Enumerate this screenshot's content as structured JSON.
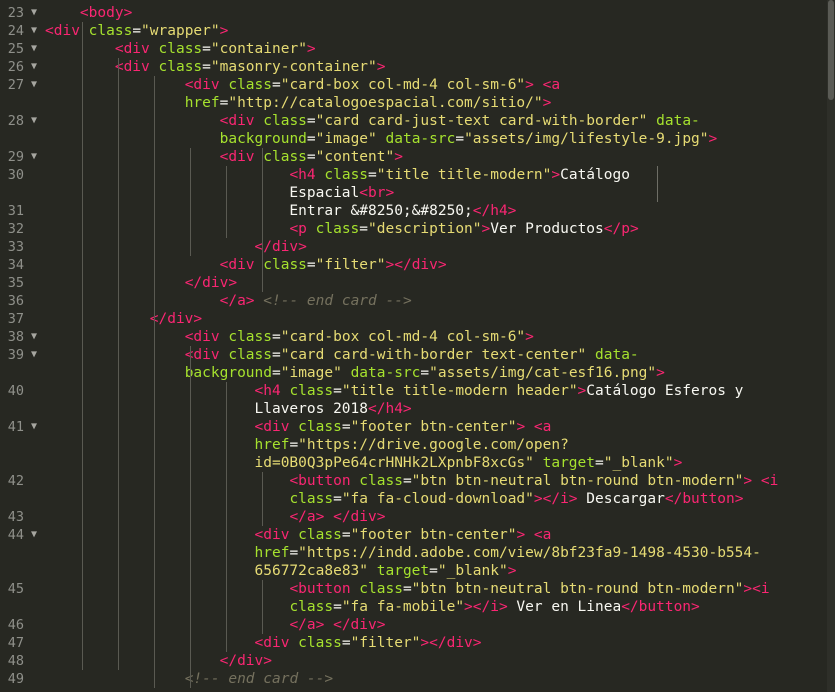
{
  "gutter": [
    {
      "n": "23",
      "fold": true
    },
    {
      "n": "24",
      "fold": true
    },
    {
      "n": "25",
      "fold": true
    },
    {
      "n": "26",
      "fold": true
    },
    {
      "n": "27",
      "fold": true
    },
    {
      "n": "",
      "fold": false
    },
    {
      "n": "28",
      "fold": true
    },
    {
      "n": "",
      "fold": false
    },
    {
      "n": "29",
      "fold": true
    },
    {
      "n": "30",
      "fold": false
    },
    {
      "n": "",
      "fold": false
    },
    {
      "n": "31",
      "fold": false
    },
    {
      "n": "32",
      "fold": false
    },
    {
      "n": "33",
      "fold": false
    },
    {
      "n": "34",
      "fold": false
    },
    {
      "n": "35",
      "fold": false
    },
    {
      "n": "36",
      "fold": false
    },
    {
      "n": "37",
      "fold": false
    },
    {
      "n": "38",
      "fold": true
    },
    {
      "n": "39",
      "fold": true
    },
    {
      "n": "",
      "fold": false
    },
    {
      "n": "40",
      "fold": false
    },
    {
      "n": "",
      "fold": false
    },
    {
      "n": "41",
      "fold": true
    },
    {
      "n": "",
      "fold": false
    },
    {
      "n": "",
      "fold": false
    },
    {
      "n": "42",
      "fold": false
    },
    {
      "n": "",
      "fold": false
    },
    {
      "n": "43",
      "fold": false
    },
    {
      "n": "44",
      "fold": true
    },
    {
      "n": "",
      "fold": false
    },
    {
      "n": "",
      "fold": false
    },
    {
      "n": "45",
      "fold": false
    },
    {
      "n": "",
      "fold": false
    },
    {
      "n": "46",
      "fold": false
    },
    {
      "n": "47",
      "fold": false
    },
    {
      "n": "48",
      "fold": false
    },
    {
      "n": "49",
      "fold": false
    }
  ],
  "lines": [
    [
      {
        "k": "p",
        "v": "    "
      },
      {
        "k": "t",
        "v": "<body>"
      }
    ],
    [
      {
        "k": "t",
        "v": "<div"
      },
      {
        "k": "p",
        "v": " "
      },
      {
        "k": "a",
        "v": "class"
      },
      {
        "k": "p",
        "v": "="
      },
      {
        "k": "s",
        "v": "\"wrapper\""
      },
      {
        "k": "t",
        "v": ">"
      }
    ],
    [
      {
        "k": "p",
        "v": "        "
      },
      {
        "k": "t",
        "v": "<div"
      },
      {
        "k": "p",
        "v": " "
      },
      {
        "k": "a",
        "v": "class"
      },
      {
        "k": "p",
        "v": "="
      },
      {
        "k": "s",
        "v": "\"container\""
      },
      {
        "k": "t",
        "v": ">"
      }
    ],
    [
      {
        "k": "p",
        "v": "        "
      },
      {
        "k": "t",
        "v": "<div"
      },
      {
        "k": "p",
        "v": " "
      },
      {
        "k": "a",
        "v": "class"
      },
      {
        "k": "p",
        "v": "="
      },
      {
        "k": "s",
        "v": "\"masonry-container\""
      },
      {
        "k": "t",
        "v": ">"
      }
    ],
    [
      {
        "k": "p",
        "v": "                "
      },
      {
        "k": "t",
        "v": "<div"
      },
      {
        "k": "p",
        "v": " "
      },
      {
        "k": "a",
        "v": "class"
      },
      {
        "k": "p",
        "v": "="
      },
      {
        "k": "s",
        "v": "\"card-box col-md-4 col-sm-6\""
      },
      {
        "k": "t",
        "v": ">"
      },
      {
        "k": "p",
        "v": " "
      },
      {
        "k": "t",
        "v": "<a"
      }
    ],
    [
      {
        "k": "p",
        "v": "                "
      },
      {
        "k": "a",
        "v": "href"
      },
      {
        "k": "p",
        "v": "="
      },
      {
        "k": "s",
        "v": "\"http://catalogoespacial.com/sitio/\""
      },
      {
        "k": "t",
        "v": ">"
      }
    ],
    [
      {
        "k": "p",
        "v": "                    "
      },
      {
        "k": "t",
        "v": "<div"
      },
      {
        "k": "p",
        "v": " "
      },
      {
        "k": "a",
        "v": "class"
      },
      {
        "k": "p",
        "v": "="
      },
      {
        "k": "s",
        "v": "\"card card-just-text card-with-border\""
      },
      {
        "k": "p",
        "v": " "
      },
      {
        "k": "a",
        "v": "data-"
      }
    ],
    [
      {
        "k": "p",
        "v": "                    "
      },
      {
        "k": "a",
        "v": "background"
      },
      {
        "k": "p",
        "v": "="
      },
      {
        "k": "s",
        "v": "\"image\""
      },
      {
        "k": "p",
        "v": " "
      },
      {
        "k": "a",
        "v": "data-src"
      },
      {
        "k": "p",
        "v": "="
      },
      {
        "k": "s",
        "v": "\"assets/img/lifestyle-9.jpg\""
      },
      {
        "k": "t",
        "v": ">"
      }
    ],
    [
      {
        "k": "p",
        "v": "                    "
      },
      {
        "k": "t",
        "v": "<div"
      },
      {
        "k": "p",
        "v": " "
      },
      {
        "k": "a",
        "v": "class"
      },
      {
        "k": "p",
        "v": "="
      },
      {
        "k": "s",
        "v": "\"content\""
      },
      {
        "k": "t",
        "v": ">"
      }
    ],
    [
      {
        "k": "p",
        "v": "                            "
      },
      {
        "k": "t",
        "v": "<h4"
      },
      {
        "k": "p",
        "v": " "
      },
      {
        "k": "a",
        "v": "class"
      },
      {
        "k": "p",
        "v": "="
      },
      {
        "k": "s",
        "v": "\"title title-modern\""
      },
      {
        "k": "t",
        "v": ">"
      },
      {
        "k": "p",
        "v": "Catálogo"
      }
    ],
    [
      {
        "k": "p",
        "v": "                            Espacial"
      },
      {
        "k": "t",
        "v": "<br>"
      }
    ],
    [
      {
        "k": "p",
        "v": "                            Entrar &#8250;&#8250;"
      },
      {
        "k": "t",
        "v": "</h4>"
      }
    ],
    [
      {
        "k": "p",
        "v": "                            "
      },
      {
        "k": "t",
        "v": "<p"
      },
      {
        "k": "p",
        "v": " "
      },
      {
        "k": "a",
        "v": "class"
      },
      {
        "k": "p",
        "v": "="
      },
      {
        "k": "s",
        "v": "\"description\""
      },
      {
        "k": "t",
        "v": ">"
      },
      {
        "k": "p",
        "v": "Ver Productos"
      },
      {
        "k": "t",
        "v": "</p>"
      }
    ],
    [
      {
        "k": "p",
        "v": "                        "
      },
      {
        "k": "t",
        "v": "</div>"
      }
    ],
    [
      {
        "k": "p",
        "v": "                    "
      },
      {
        "k": "t",
        "v": "<div"
      },
      {
        "k": "p",
        "v": " "
      },
      {
        "k": "a",
        "v": "class"
      },
      {
        "k": "p",
        "v": "="
      },
      {
        "k": "s",
        "v": "\"filter\""
      },
      {
        "k": "t",
        "v": "></div>"
      }
    ],
    [
      {
        "k": "p",
        "v": "                "
      },
      {
        "k": "t",
        "v": "</div>"
      }
    ],
    [
      {
        "k": "p",
        "v": "                    "
      },
      {
        "k": "t",
        "v": "</a>"
      },
      {
        "k": "p",
        "v": " "
      },
      {
        "k": "c",
        "v": "<!-- end card -->"
      }
    ],
    [
      {
        "k": "p",
        "v": "            "
      },
      {
        "k": "t",
        "v": "</div>"
      }
    ],
    [
      {
        "k": "p",
        "v": "                "
      },
      {
        "k": "t",
        "v": "<div"
      },
      {
        "k": "p",
        "v": " "
      },
      {
        "k": "a",
        "v": "class"
      },
      {
        "k": "p",
        "v": "="
      },
      {
        "k": "s",
        "v": "\"card-box col-md-4 col-sm-6\""
      },
      {
        "k": "t",
        "v": ">"
      }
    ],
    [
      {
        "k": "p",
        "v": "                "
      },
      {
        "k": "t",
        "v": "<div"
      },
      {
        "k": "p",
        "v": " "
      },
      {
        "k": "a",
        "v": "class"
      },
      {
        "k": "p",
        "v": "="
      },
      {
        "k": "s",
        "v": "\"card card-with-border text-center\""
      },
      {
        "k": "p",
        "v": " "
      },
      {
        "k": "a",
        "v": "data-"
      }
    ],
    [
      {
        "k": "p",
        "v": "                "
      },
      {
        "k": "a",
        "v": "background"
      },
      {
        "k": "p",
        "v": "="
      },
      {
        "k": "s",
        "v": "\"image\""
      },
      {
        "k": "p",
        "v": " "
      },
      {
        "k": "a",
        "v": "data-src"
      },
      {
        "k": "p",
        "v": "="
      },
      {
        "k": "s",
        "v": "\"assets/img/cat-esf16.png\""
      },
      {
        "k": "t",
        "v": ">"
      }
    ],
    [
      {
        "k": "p",
        "v": "                        "
      },
      {
        "k": "t",
        "v": "<h4"
      },
      {
        "k": "p",
        "v": " "
      },
      {
        "k": "a",
        "v": "class"
      },
      {
        "k": "p",
        "v": "="
      },
      {
        "k": "s",
        "v": "\"title title-modern header\""
      },
      {
        "k": "t",
        "v": ">"
      },
      {
        "k": "p",
        "v": "Catálogo Esferos y"
      }
    ],
    [
      {
        "k": "p",
        "v": "                        Llaveros 2018"
      },
      {
        "k": "t",
        "v": "</h4>"
      }
    ],
    [
      {
        "k": "p",
        "v": "                        "
      },
      {
        "k": "t",
        "v": "<div"
      },
      {
        "k": "p",
        "v": " "
      },
      {
        "k": "a",
        "v": "class"
      },
      {
        "k": "p",
        "v": "="
      },
      {
        "k": "s",
        "v": "\"footer btn-center\""
      },
      {
        "k": "t",
        "v": ">"
      },
      {
        "k": "p",
        "v": " "
      },
      {
        "k": "t",
        "v": "<a"
      }
    ],
    [
      {
        "k": "p",
        "v": "                        "
      },
      {
        "k": "a",
        "v": "href"
      },
      {
        "k": "p",
        "v": "="
      },
      {
        "k": "s",
        "v": "\"https://drive.google.com/open?"
      }
    ],
    [
      {
        "k": "p",
        "v": "                        "
      },
      {
        "k": "s",
        "v": "id=0B0Q3pPe64crHNHk2LXpnbF8xcGs\""
      },
      {
        "k": "p",
        "v": " "
      },
      {
        "k": "a",
        "v": "target"
      },
      {
        "k": "p",
        "v": "="
      },
      {
        "k": "s",
        "v": "\"_blank\""
      },
      {
        "k": "t",
        "v": ">"
      }
    ],
    [
      {
        "k": "p",
        "v": "                            "
      },
      {
        "k": "t",
        "v": "<button"
      },
      {
        "k": "p",
        "v": " "
      },
      {
        "k": "a",
        "v": "class"
      },
      {
        "k": "p",
        "v": "="
      },
      {
        "k": "s",
        "v": "\"btn btn-neutral btn-round btn-modern\""
      },
      {
        "k": "t",
        "v": ">"
      },
      {
        "k": "p",
        "v": " "
      },
      {
        "k": "t",
        "v": "<i"
      }
    ],
    [
      {
        "k": "p",
        "v": "                            "
      },
      {
        "k": "a",
        "v": "class"
      },
      {
        "k": "p",
        "v": "="
      },
      {
        "k": "s",
        "v": "\"fa fa-cloud-download\""
      },
      {
        "k": "t",
        "v": "></i>"
      },
      {
        "k": "p",
        "v": " Descargar"
      },
      {
        "k": "t",
        "v": "</button>"
      }
    ],
    [
      {
        "k": "p",
        "v": "                            "
      },
      {
        "k": "t",
        "v": "</a>"
      },
      {
        "k": "p",
        "v": " "
      },
      {
        "k": "t",
        "v": "</div>"
      }
    ],
    [
      {
        "k": "p",
        "v": "                        "
      },
      {
        "k": "t",
        "v": "<div"
      },
      {
        "k": "p",
        "v": " "
      },
      {
        "k": "a",
        "v": "class"
      },
      {
        "k": "p",
        "v": "="
      },
      {
        "k": "s",
        "v": "\"footer btn-center\""
      },
      {
        "k": "t",
        "v": ">"
      },
      {
        "k": "p",
        "v": " "
      },
      {
        "k": "t",
        "v": "<a"
      }
    ],
    [
      {
        "k": "p",
        "v": "                        "
      },
      {
        "k": "a",
        "v": "href"
      },
      {
        "k": "p",
        "v": "="
      },
      {
        "k": "s",
        "v": "\"https://indd.adobe.com/view/8bf23fa9-1498-4530-b554-"
      }
    ],
    [
      {
        "k": "p",
        "v": "                        "
      },
      {
        "k": "s",
        "v": "656772ca8e83\""
      },
      {
        "k": "p",
        "v": " "
      },
      {
        "k": "a",
        "v": "target"
      },
      {
        "k": "p",
        "v": "="
      },
      {
        "k": "s",
        "v": "\"_blank\""
      },
      {
        "k": "t",
        "v": ">"
      }
    ],
    [
      {
        "k": "p",
        "v": "                            "
      },
      {
        "k": "t",
        "v": "<button"
      },
      {
        "k": "p",
        "v": " "
      },
      {
        "k": "a",
        "v": "class"
      },
      {
        "k": "p",
        "v": "="
      },
      {
        "k": "s",
        "v": "\"btn btn-neutral btn-round btn-modern\""
      },
      {
        "k": "t",
        "v": "><i"
      }
    ],
    [
      {
        "k": "p",
        "v": "                            "
      },
      {
        "k": "a",
        "v": "class"
      },
      {
        "k": "p",
        "v": "="
      },
      {
        "k": "s",
        "v": "\"fa fa-mobile\""
      },
      {
        "k": "t",
        "v": "></i>"
      },
      {
        "k": "p",
        "v": " Ver en Linea"
      },
      {
        "k": "t",
        "v": "</button>"
      }
    ],
    [
      {
        "k": "p",
        "v": "                            "
      },
      {
        "k": "t",
        "v": "</a>"
      },
      {
        "k": "p",
        "v": " "
      },
      {
        "k": "t",
        "v": "</div>"
      }
    ],
    [
      {
        "k": "p",
        "v": "                        "
      },
      {
        "k": "t",
        "v": "<div"
      },
      {
        "k": "p",
        "v": " "
      },
      {
        "k": "a",
        "v": "class"
      },
      {
        "k": "p",
        "v": "="
      },
      {
        "k": "s",
        "v": "\"filter\""
      },
      {
        "k": "t",
        "v": "></div>"
      }
    ],
    [
      {
        "k": "p",
        "v": "                    "
      },
      {
        "k": "t",
        "v": "</div>"
      }
    ],
    [
      {
        "k": "p",
        "v": "                "
      },
      {
        "k": "c",
        "v": "<!-- end card -->"
      }
    ]
  ],
  "theme": {
    "background": "#272822",
    "tag": "#f92672",
    "attribute": "#a6e22e",
    "string": "#e6db74",
    "text": "#f8f8f2",
    "comment": "#75715e",
    "line_number": "#8f908a"
  }
}
